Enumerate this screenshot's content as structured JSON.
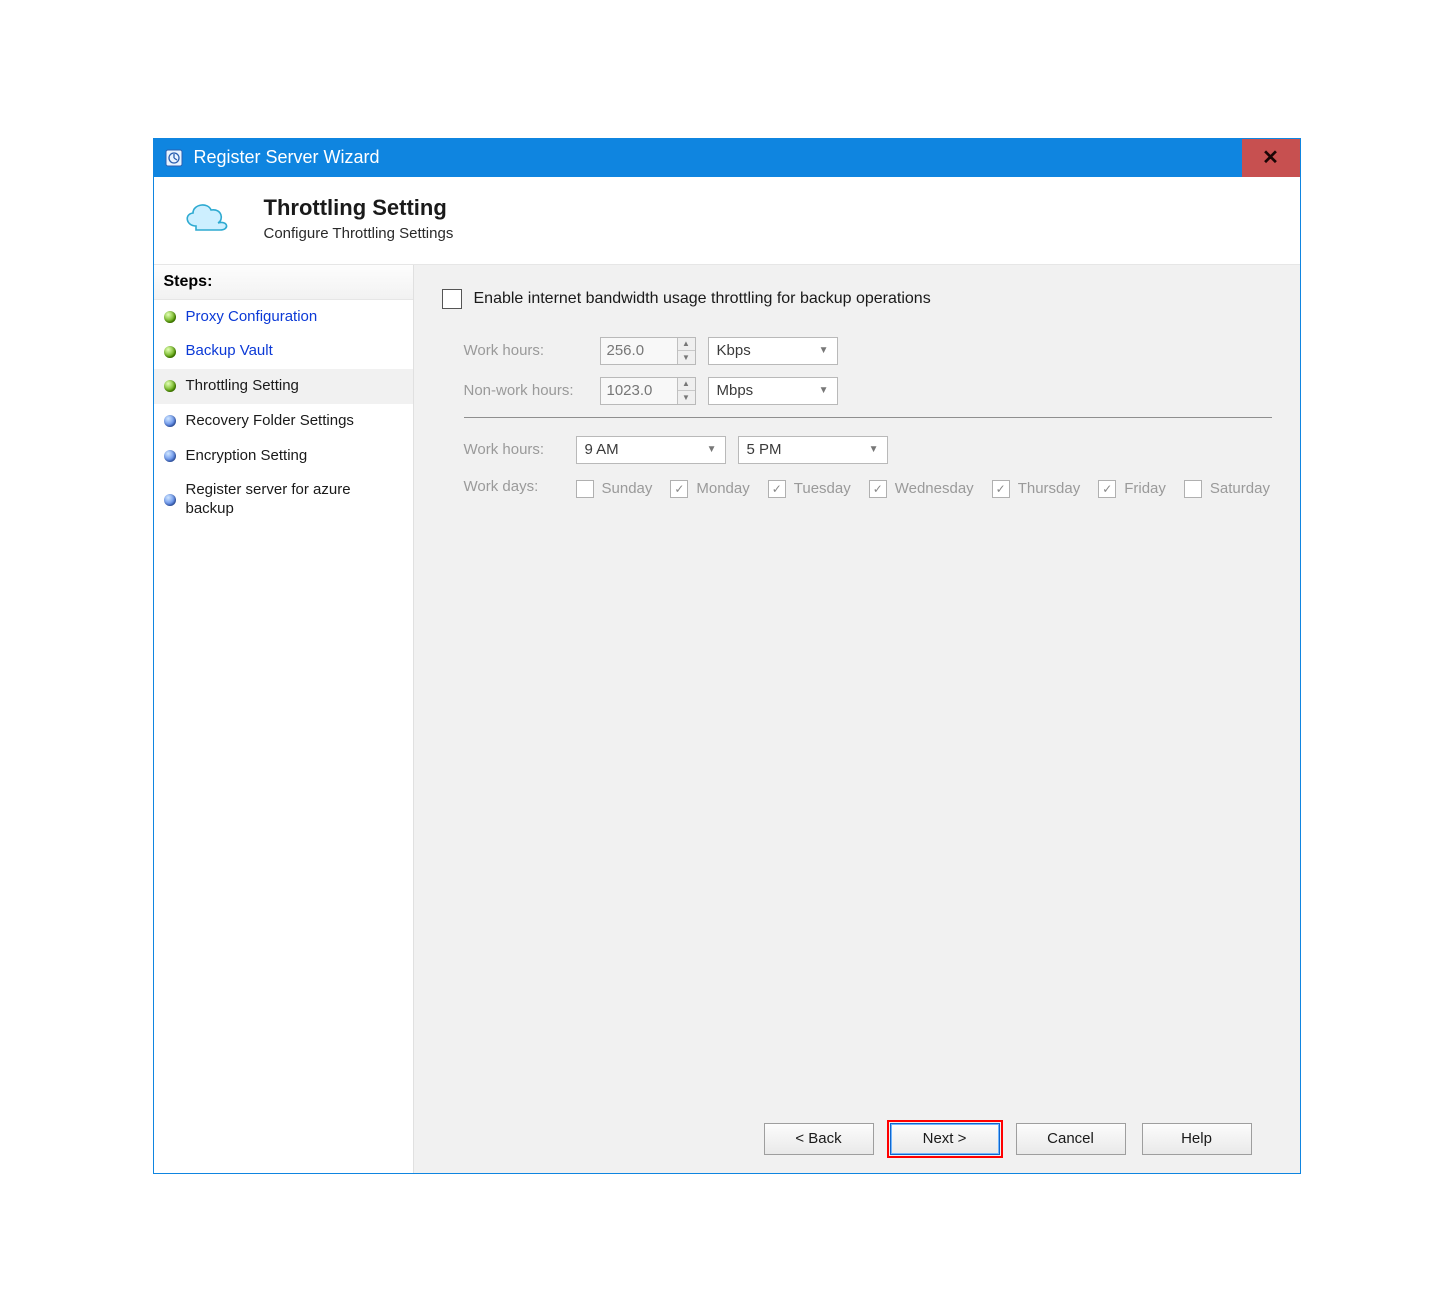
{
  "window": {
    "title": "Register Server Wizard"
  },
  "header": {
    "title": "Throttling Setting",
    "subtitle": "Configure Throttling Settings"
  },
  "steps": {
    "heading": "Steps:",
    "items": [
      {
        "label": "Proxy Configuration",
        "state": "done-link"
      },
      {
        "label": "Backup Vault",
        "state": "done-link"
      },
      {
        "label": "Throttling Setting",
        "state": "current"
      },
      {
        "label": "Recovery Folder Settings",
        "state": "pending"
      },
      {
        "label": "Encryption Setting",
        "state": "pending"
      },
      {
        "label": "Register server for azure backup",
        "state": "pending"
      }
    ]
  },
  "main": {
    "enable_label": "Enable internet bandwidth usage throttling for backup operations",
    "work_hours_label": "Work hours:",
    "nonwork_hours_label": "Non-work hours:",
    "work_hours_value": "256.0",
    "work_hours_unit": "Kbps",
    "nonwork_hours_value": "1023.0",
    "nonwork_hours_unit": "Mbps",
    "work_hours_time_label": "Work hours:",
    "work_hours_from": "9 AM",
    "work_hours_to": "5 PM",
    "work_days_label": "Work days:",
    "days": [
      {
        "label": "Sunday",
        "checked": false
      },
      {
        "label": "Monday",
        "checked": true
      },
      {
        "label": "Tuesday",
        "checked": true
      },
      {
        "label": "Wednesday",
        "checked": true
      },
      {
        "label": "Thursday",
        "checked": true
      },
      {
        "label": "Friday",
        "checked": true
      },
      {
        "label": "Saturday",
        "checked": false
      }
    ]
  },
  "footer": {
    "back": "< Back",
    "next": "Next >",
    "cancel": "Cancel",
    "help": "Help"
  }
}
